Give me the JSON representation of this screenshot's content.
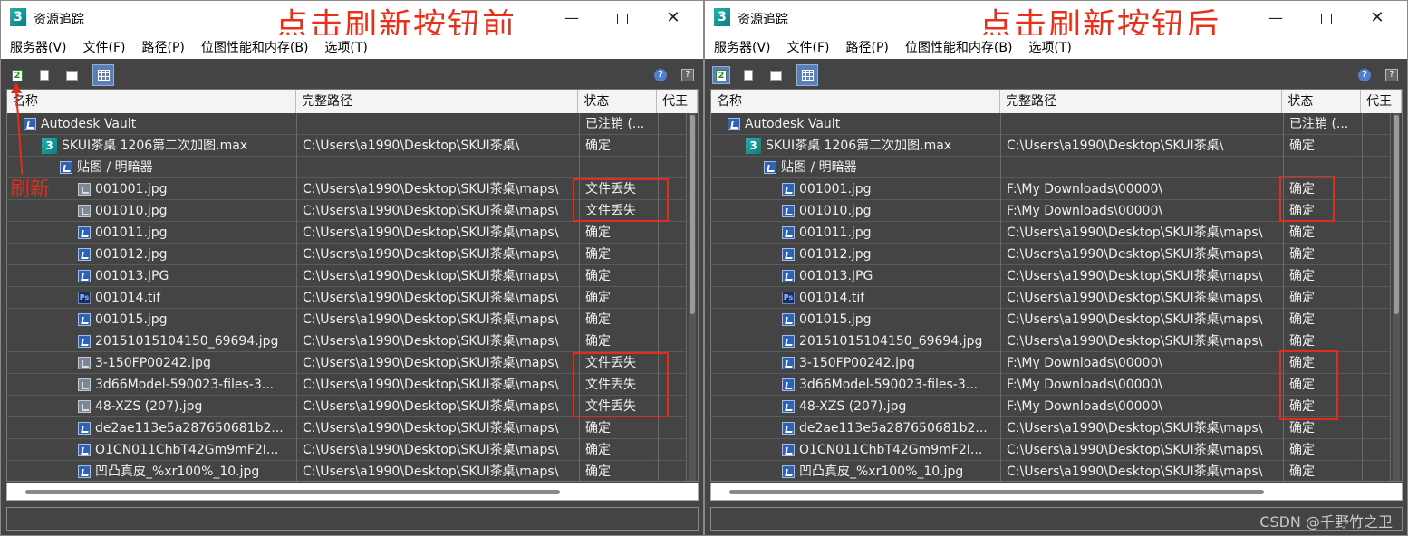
{
  "window": {
    "title": "资源追踪",
    "icon_letter": "3",
    "minimize": "—",
    "close": "✕"
  },
  "captions": {
    "before": "点击刷新按钮前",
    "after": "点击刷新按钮后"
  },
  "annotation": {
    "refresh_label": "刷新"
  },
  "menu": [
    "服务器(V)",
    "文件(F)",
    "路径(P)",
    "位图性能和内存(B)",
    "选项(T)"
  ],
  "toolbar": {
    "refresh_icon": "2",
    "help_icon": "?",
    "help2_icon": "?"
  },
  "columns": [
    "名称",
    "完整路径",
    "状态",
    "代王"
  ],
  "left_rows": [
    {
      "name": "Autodesk Vault",
      "path": "",
      "status": "已注销 (...",
      "icon": "vault",
      "indent": 1
    },
    {
      "name": "SKUI茶桌 1206第二次加图.max",
      "path": "C:\\Users\\a1990\\Desktop\\SKUI茶桌\\",
      "status": "确定",
      "icon": "max",
      "indent": 2
    },
    {
      "name": "贴图 / 明暗器",
      "path": "",
      "status": "",
      "icon": "folder",
      "indent": 3
    },
    {
      "name": "001001.jpg",
      "path": "C:\\Users\\a1990\\Desktop\\SKUI茶桌\\maps\\",
      "status": "文件丢失",
      "icon": "missing",
      "indent": 4
    },
    {
      "name": "001010.jpg",
      "path": "C:\\Users\\a1990\\Desktop\\SKUI茶桌\\maps\\",
      "status": "文件丢失",
      "icon": "missing",
      "indent": 4
    },
    {
      "name": "001011.jpg",
      "path": "C:\\Users\\a1990\\Desktop\\SKUI茶桌\\maps\\",
      "status": "确定",
      "icon": "img",
      "indent": 4
    },
    {
      "name": "001012.jpg",
      "path": "C:\\Users\\a1990\\Desktop\\SKUI茶桌\\maps\\",
      "status": "确定",
      "icon": "img",
      "indent": 4
    },
    {
      "name": "001013.JPG",
      "path": "C:\\Users\\a1990\\Desktop\\SKUI茶桌\\maps\\",
      "status": "确定",
      "icon": "img",
      "indent": 4
    },
    {
      "name": "001014.tif",
      "path": "C:\\Users\\a1990\\Desktop\\SKUI茶桌\\maps\\",
      "status": "确定",
      "icon": "ps",
      "indent": 4
    },
    {
      "name": "001015.jpg",
      "path": "C:\\Users\\a1990\\Desktop\\SKUI茶桌\\maps\\",
      "status": "确定",
      "icon": "img",
      "indent": 4
    },
    {
      "name": "20151015104150_69694.jpg",
      "path": "C:\\Users\\a1990\\Desktop\\SKUI茶桌\\maps\\",
      "status": "确定",
      "icon": "img",
      "indent": 4
    },
    {
      "name": "3-150FP00242.jpg",
      "path": "C:\\Users\\a1990\\Desktop\\SKUI茶桌\\maps\\",
      "status": "文件丢失",
      "icon": "missing",
      "indent": 4
    },
    {
      "name": "3d66Model-590023-files-3...",
      "path": "C:\\Users\\a1990\\Desktop\\SKUI茶桌\\maps\\",
      "status": "文件丢失",
      "icon": "missing",
      "indent": 4
    },
    {
      "name": "48-XZS (207).jpg",
      "path": "C:\\Users\\a1990\\Desktop\\SKUI茶桌\\maps\\",
      "status": "文件丢失",
      "icon": "missing",
      "indent": 4
    },
    {
      "name": "de2ae113e5a287650681b2...",
      "path": "C:\\Users\\a1990\\Desktop\\SKUI茶桌\\maps\\",
      "status": "确定",
      "icon": "img",
      "indent": 4
    },
    {
      "name": "O1CN011ChbT42Gm9mF2I...",
      "path": "C:\\Users\\a1990\\Desktop\\SKUI茶桌\\maps\\",
      "status": "确定",
      "icon": "img",
      "indent": 4
    },
    {
      "name": "凹凸真皮_%xr100%_10.jpg",
      "path": "C:\\Users\\a1990\\Desktop\\SKUI茶桌\\maps\\",
      "status": "确定",
      "icon": "img",
      "indent": 4
    }
  ],
  "right_rows": [
    {
      "name": "Autodesk Vault",
      "path": "",
      "status": "已注销 (...",
      "icon": "vault",
      "indent": 1
    },
    {
      "name": "SKUI茶桌 1206第二次加图.max",
      "path": "C:\\Users\\a1990\\Desktop\\SKUI茶桌\\",
      "status": "确定",
      "icon": "max",
      "indent": 2
    },
    {
      "name": "贴图 / 明暗器",
      "path": "",
      "status": "",
      "icon": "folder",
      "indent": 3
    },
    {
      "name": "001001.jpg",
      "path": "F:\\My Downloads\\00000\\",
      "status": "确定",
      "icon": "img",
      "indent": 4
    },
    {
      "name": "001010.jpg",
      "path": "F:\\My Downloads\\00000\\",
      "status": "确定",
      "icon": "img",
      "indent": 4
    },
    {
      "name": "001011.jpg",
      "path": "C:\\Users\\a1990\\Desktop\\SKUI茶桌\\maps\\",
      "status": "确定",
      "icon": "img",
      "indent": 4
    },
    {
      "name": "001012.jpg",
      "path": "C:\\Users\\a1990\\Desktop\\SKUI茶桌\\maps\\",
      "status": "确定",
      "icon": "img",
      "indent": 4
    },
    {
      "name": "001013.JPG",
      "path": "C:\\Users\\a1990\\Desktop\\SKUI茶桌\\maps\\",
      "status": "确定",
      "icon": "img",
      "indent": 4
    },
    {
      "name": "001014.tif",
      "path": "C:\\Users\\a1990\\Desktop\\SKUI茶桌\\maps\\",
      "status": "确定",
      "icon": "ps",
      "indent": 4
    },
    {
      "name": "001015.jpg",
      "path": "C:\\Users\\a1990\\Desktop\\SKUI茶桌\\maps\\",
      "status": "确定",
      "icon": "img",
      "indent": 4
    },
    {
      "name": "20151015104150_69694.jpg",
      "path": "C:\\Users\\a1990\\Desktop\\SKUI茶桌\\maps\\",
      "status": "确定",
      "icon": "img",
      "indent": 4
    },
    {
      "name": "3-150FP00242.jpg",
      "path": "F:\\My Downloads\\00000\\",
      "status": "确定",
      "icon": "img",
      "indent": 4
    },
    {
      "name": "3d66Model-590023-files-3...",
      "path": "F:\\My Downloads\\00000\\",
      "status": "确定",
      "icon": "img",
      "indent": 4
    },
    {
      "name": "48-XZS (207).jpg",
      "path": "F:\\My Downloads\\00000\\",
      "status": "确定",
      "icon": "img",
      "indent": 4
    },
    {
      "name": "de2ae113e5a287650681b2...",
      "path": "C:\\Users\\a1990\\Desktop\\SKUI茶桌\\maps\\",
      "status": "确定",
      "icon": "img",
      "indent": 4
    },
    {
      "name": "O1CN011ChbT42Gm9mF2I...",
      "path": "C:\\Users\\a1990\\Desktop\\SKUI茶桌\\maps\\",
      "status": "确定",
      "icon": "img",
      "indent": 4
    },
    {
      "name": "凹凸真皮_%xr100%_10.jpg",
      "path": "C:\\Users\\a1990\\Desktop\\SKUI茶桌\\maps\\",
      "status": "确定",
      "icon": "img",
      "indent": 4
    }
  ],
  "watermark": "CSDN @千野竹之卫",
  "colors": {
    "annotation_red": "#e02d1c",
    "panel_bg": "#444444",
    "accent_blue": "#5a7fb3"
  }
}
